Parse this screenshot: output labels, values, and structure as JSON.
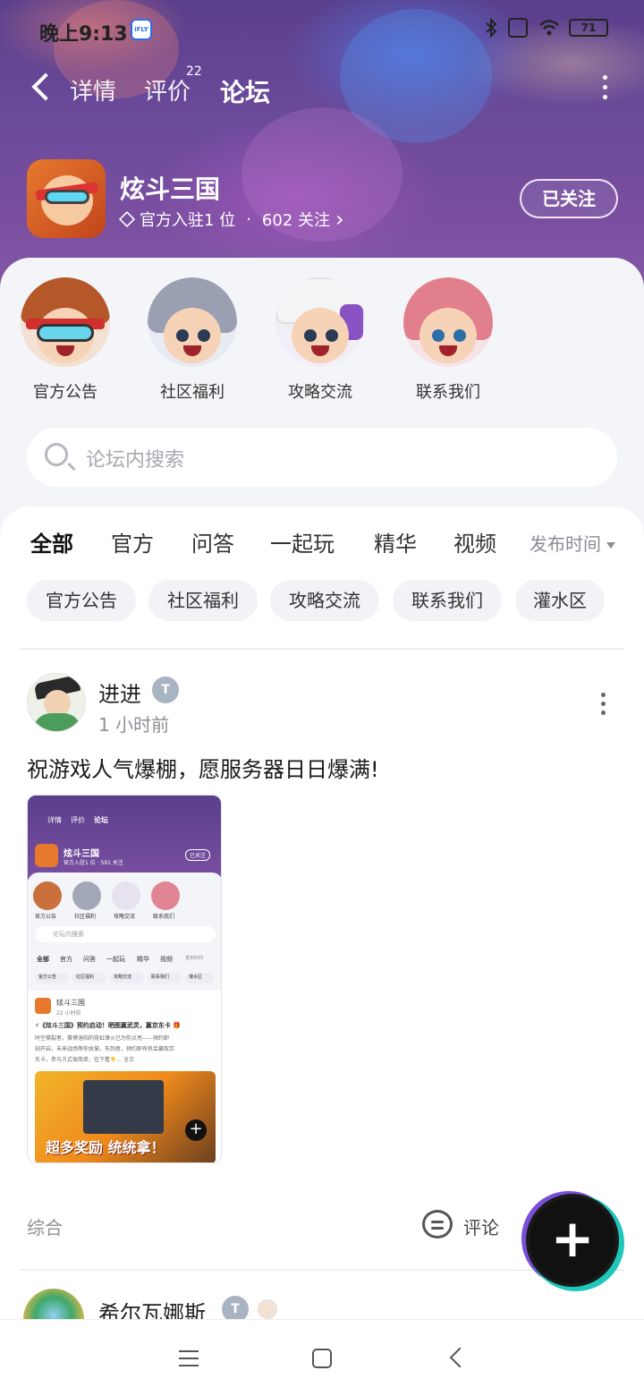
{
  "status_bar": {
    "time": "晚上9:13",
    "ifly_label": "iFLY",
    "battery": "71"
  },
  "nav": {
    "tabs": [
      {
        "label": "详情"
      },
      {
        "label": "评价"
      },
      {
        "label": "论坛"
      }
    ],
    "review_count": "22",
    "active_tab": "论坛"
  },
  "game": {
    "title": "炫斗三国",
    "official_text": "官方入驻1 位",
    "separator": "·",
    "followers_text": "602 关注",
    "chevron": "›",
    "follow_button": "已关注"
  },
  "categories": [
    {
      "label": "官方公告"
    },
    {
      "label": "社区福利"
    },
    {
      "label": "攻略交流"
    },
    {
      "label": "联系我们"
    }
  ],
  "search": {
    "placeholder": "论坛内搜索"
  },
  "feed_tabs": [
    {
      "label": "全部"
    },
    {
      "label": "官方"
    },
    {
      "label": "问答"
    },
    {
      "label": "一起玩"
    },
    {
      "label": "精华"
    },
    {
      "label": "视频"
    }
  ],
  "sort_label": "发布时间",
  "chips": [
    {
      "label": "官方公告"
    },
    {
      "label": "社区福利"
    },
    {
      "label": "攻略交流"
    },
    {
      "label": "联系我们"
    },
    {
      "label": "灌水区"
    }
  ],
  "post": {
    "author": "进进",
    "level_badge": "T",
    "time_ago": "1 小时前",
    "text": "祝游戏人气爆棚，愿服务器日日爆满!",
    "category": "综合",
    "comment_label": "评论"
  },
  "thumbnail": {
    "nav": [
      "详情",
      "评价",
      "论坛"
    ],
    "title": "炫斗三国",
    "meta": "官方入驻1 位 · 591 关注",
    "follow": "已关注",
    "cats": [
      "官方公告",
      "社区福利",
      "攻略交流",
      "联系我们"
    ],
    "search": "论坛内搜索",
    "tabs": [
      "全部",
      "官方",
      "问答",
      "一起玩",
      "精华",
      "视频",
      "发布时间"
    ],
    "chips": [
      "官方公告",
      "社区福利",
      "攻略交流",
      "联系我们",
      "灌水区"
    ],
    "post_author": "炫斗三国",
    "post_time": "22 小时前",
    "post_title": "⚡《炫斗三国》预约启动！晒图赢武灵，赢京东卡 🎁",
    "post_body1": "时空撕裂者，赛博洛阳的霓虹烽火已为你点亮——预约即",
    "post_body2": "刻开启，未来战场等你执掌。先到者，预约即有机会赢取京",
    "post_body3": "东卡，参与方式很简单，往下看👇... 全文",
    "banner_text": "超多奖励 统统拿！"
  },
  "post2": {
    "author": "希尔瓦娜斯",
    "level_badge": "T"
  },
  "fab_label": "+"
}
